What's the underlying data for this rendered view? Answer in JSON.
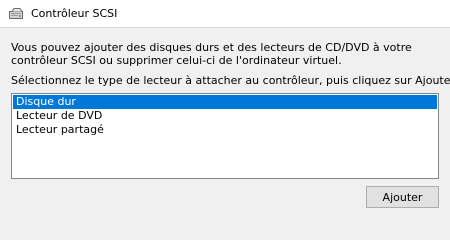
{
  "header": {
    "icon": "hard-drive-icon",
    "title": "Contrôleur SCSI"
  },
  "description": "Vous pouvez ajouter des disques durs et des lecteurs de CD/DVD à votre contrôleur SCSI ou supprimer celui-ci de l'ordinateur virtuel.",
  "instruction": "Sélectionnez le type de lecteur à attacher au contrôleur, puis cliquez sur Ajouter.",
  "drive_types": [
    {
      "label": "Disque dur",
      "selected": true
    },
    {
      "label": "Lecteur de DVD",
      "selected": false
    },
    {
      "label": "Lecteur partagé",
      "selected": false
    }
  ],
  "buttons": {
    "add_label": "Ajouter"
  },
  "colors": {
    "selection": "#0078d7",
    "background": "#f0f0f0"
  }
}
